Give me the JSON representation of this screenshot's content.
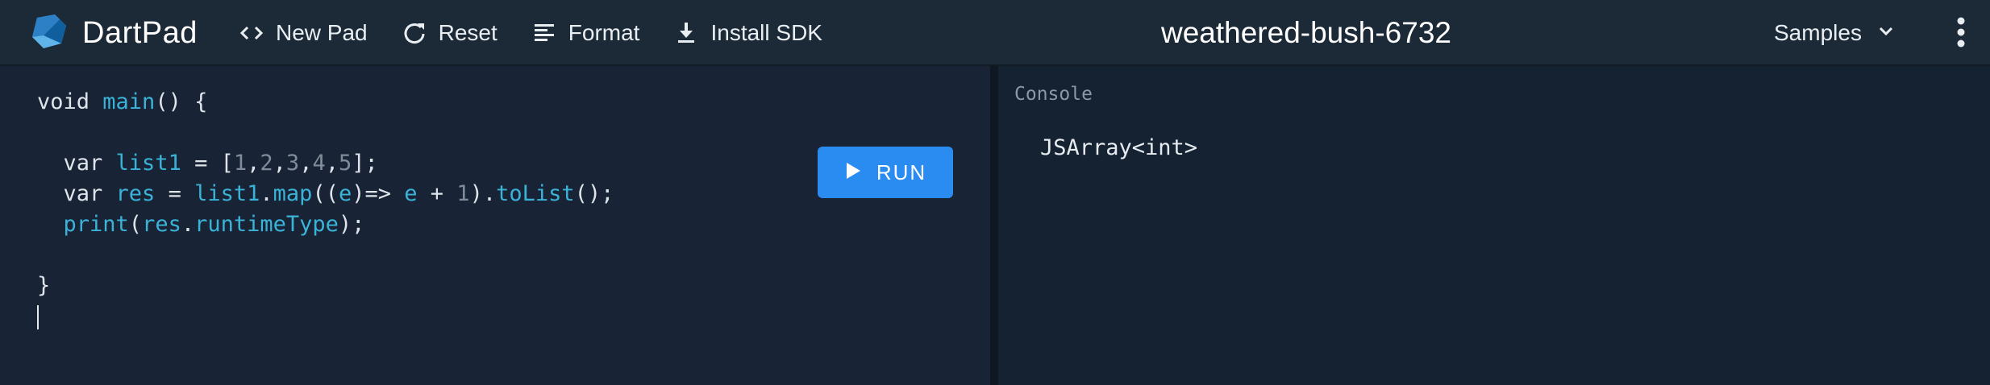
{
  "app": {
    "name": "DartPad",
    "logo_icon": "dart-logo-icon",
    "pad_title": "weathered-bush-6732"
  },
  "toolbar": {
    "new_pad": {
      "label": "New Pad",
      "icon": "code-brackets-icon"
    },
    "reset": {
      "label": "Reset",
      "icon": "refresh-icon"
    },
    "format": {
      "label": "Format",
      "icon": "format-lines-icon"
    },
    "install_sdk": {
      "label": "Install SDK",
      "icon": "download-icon"
    }
  },
  "samples": {
    "label": "Samples",
    "icon": "chevron-down-icon"
  },
  "more_menu": {
    "icon": "more-vert-icon"
  },
  "run": {
    "label": "RUN",
    "icon": "play-icon"
  },
  "editor": {
    "lines": {
      "l1": {
        "kw": "void ",
        "fn": "main",
        "rest": "() {"
      },
      "l3": {
        "kw": "  var ",
        "name": "list1",
        "op": " = [",
        "n1": "1",
        "c1": ",",
        "n2": "2",
        "c2": ",",
        "n3": "3",
        "c3": ",",
        "n4": "4",
        "c4": ",",
        "n5": "5",
        "end": "];"
      },
      "l4": {
        "kw": "  var ",
        "name": "res",
        "op": " = ",
        "obj": "list1",
        "dot": ".",
        "m1": "map",
        "p1": "((",
        "arg": "e",
        "p2": ")=> ",
        "arg2": "e",
        "plus": " + ",
        "one": "1",
        "p3": ").",
        "m2": "toList",
        "end": "();"
      },
      "l5": {
        "indent": "  ",
        "fn": "print",
        "p1": "(",
        "obj": "res",
        "dot": ".",
        "prop": "runtimeType",
        "end": ");"
      },
      "l7": {
        "text": "}"
      }
    }
  },
  "console": {
    "title": "Console",
    "output": "JSArray<int>"
  },
  "colors": {
    "accent": "#2a8cf0",
    "topbar": "#1c2a38",
    "editor_bg": "#182435",
    "console_bg": "#152232",
    "token_blue": "#3bb3d8",
    "token_number": "#7f8c99"
  }
}
